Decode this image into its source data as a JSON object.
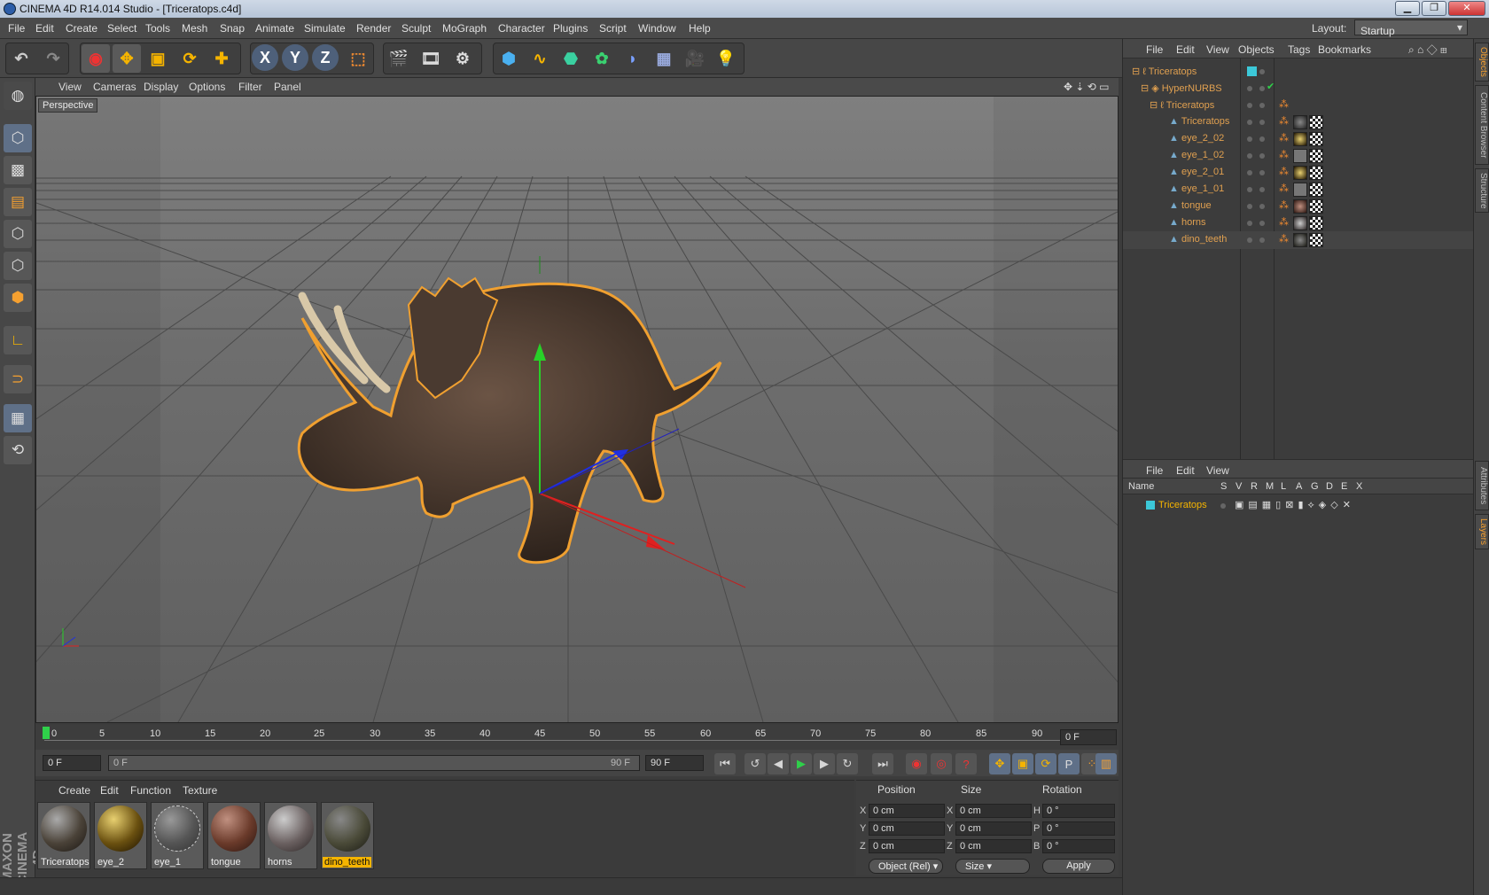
{
  "window": {
    "title": "CINEMA 4D R14.014 Studio - [Triceratops.c4d]"
  },
  "menu": [
    "File",
    "Edit",
    "Create",
    "Select",
    "Tools",
    "Mesh",
    "Snap",
    "Animate",
    "Simulate",
    "Render",
    "Sculpt",
    "MoGraph",
    "Character",
    "Plugins",
    "Script",
    "Window",
    "Help"
  ],
  "layout": {
    "label": "Layout:",
    "value": "Startup"
  },
  "toolbar": {
    "buttons": [
      "undo-icon",
      "redo-icon",
      "live-select-icon",
      "move-icon",
      "scale-icon",
      "rotate-icon",
      "add-icon",
      "x-axis-icon",
      "y-axis-icon",
      "z-axis-icon",
      "coordinate-system-icon",
      "render-view-icon",
      "render-picture-viewer-icon",
      "render-settings-icon",
      "cube-icon",
      "spline-icon",
      "nurbs-icon",
      "array-icon",
      "deformer-icon",
      "scene-icon",
      "camera-icon",
      "light-icon"
    ],
    "axis_labels": [
      "X",
      "Y",
      "Z"
    ]
  },
  "viewport_menu": [
    "View",
    "Cameras",
    "Display",
    "Options",
    "Filter",
    "Panel"
  ],
  "viewport": {
    "label": "Perspective"
  },
  "timeline": {
    "ticks": [
      "0",
      "5",
      "10",
      "15",
      "20",
      "25",
      "30",
      "35",
      "40",
      "45",
      "50",
      "55",
      "60",
      "65",
      "70",
      "75",
      "80",
      "85",
      "90"
    ],
    "current_frame": "0 F"
  },
  "transport": {
    "start": "0 F",
    "range_start": "0 F",
    "range_end": "90 F",
    "end": "90 F"
  },
  "material_menu": [
    "Create",
    "Edit",
    "Function",
    "Texture"
  ],
  "materials": [
    {
      "name": "Triceratops",
      "selected": false
    },
    {
      "name": "eye_2",
      "selected": false
    },
    {
      "name": "eye_1",
      "selected": false
    },
    {
      "name": "tongue",
      "selected": false
    },
    {
      "name": "horns",
      "selected": false
    },
    {
      "name": "dino_teeth",
      "selected": true
    }
  ],
  "coords": {
    "headers": [
      "Position",
      "Size",
      "Rotation"
    ],
    "position": {
      "X": "0 cm",
      "Y": "0 cm",
      "Z": "0 cm"
    },
    "size": {
      "X": "0 cm",
      "Y": "0 cm",
      "Z": "0 cm"
    },
    "rotation": {
      "H": "0 °",
      "P": "0 °",
      "B": "0 °"
    },
    "mode": "Object (Rel)",
    "size_mode": "Size",
    "apply": "Apply"
  },
  "object_manager": {
    "menu": [
      "File",
      "Edit",
      "View",
      "Objects",
      "Tags",
      "Bookmarks"
    ],
    "objects": [
      {
        "name": "Triceratops",
        "level": 0
      },
      {
        "name": "HyperNURBS",
        "level": 1
      },
      {
        "name": "Triceratops",
        "level": 2
      },
      {
        "name": "Triceratops",
        "level": 3
      },
      {
        "name": "eye_2_02",
        "level": 3
      },
      {
        "name": "eye_1_02",
        "level": 3
      },
      {
        "name": "eye_2_01",
        "level": 3
      },
      {
        "name": "eye_1_01",
        "level": 3
      },
      {
        "name": "tongue",
        "level": 3
      },
      {
        "name": "horns",
        "level": 3
      },
      {
        "name": "dino_teeth",
        "level": 3
      }
    ]
  },
  "layer_manager": {
    "menu": [
      "File",
      "Edit",
      "View"
    ],
    "columns": [
      "Name",
      "S",
      "V",
      "R",
      "M",
      "L",
      "A",
      "G",
      "D",
      "E",
      "X"
    ],
    "layers": [
      {
        "name": "Triceratops",
        "color": "#3cc8d8"
      }
    ]
  },
  "side_tabs": [
    "Objects",
    "Content Browser",
    "Structure",
    "Attributes",
    "Layers"
  ],
  "colors": {
    "accent_orange": "#f0a030",
    "selection_yellow": "#f5b400",
    "play_green": "#2fd04a"
  }
}
